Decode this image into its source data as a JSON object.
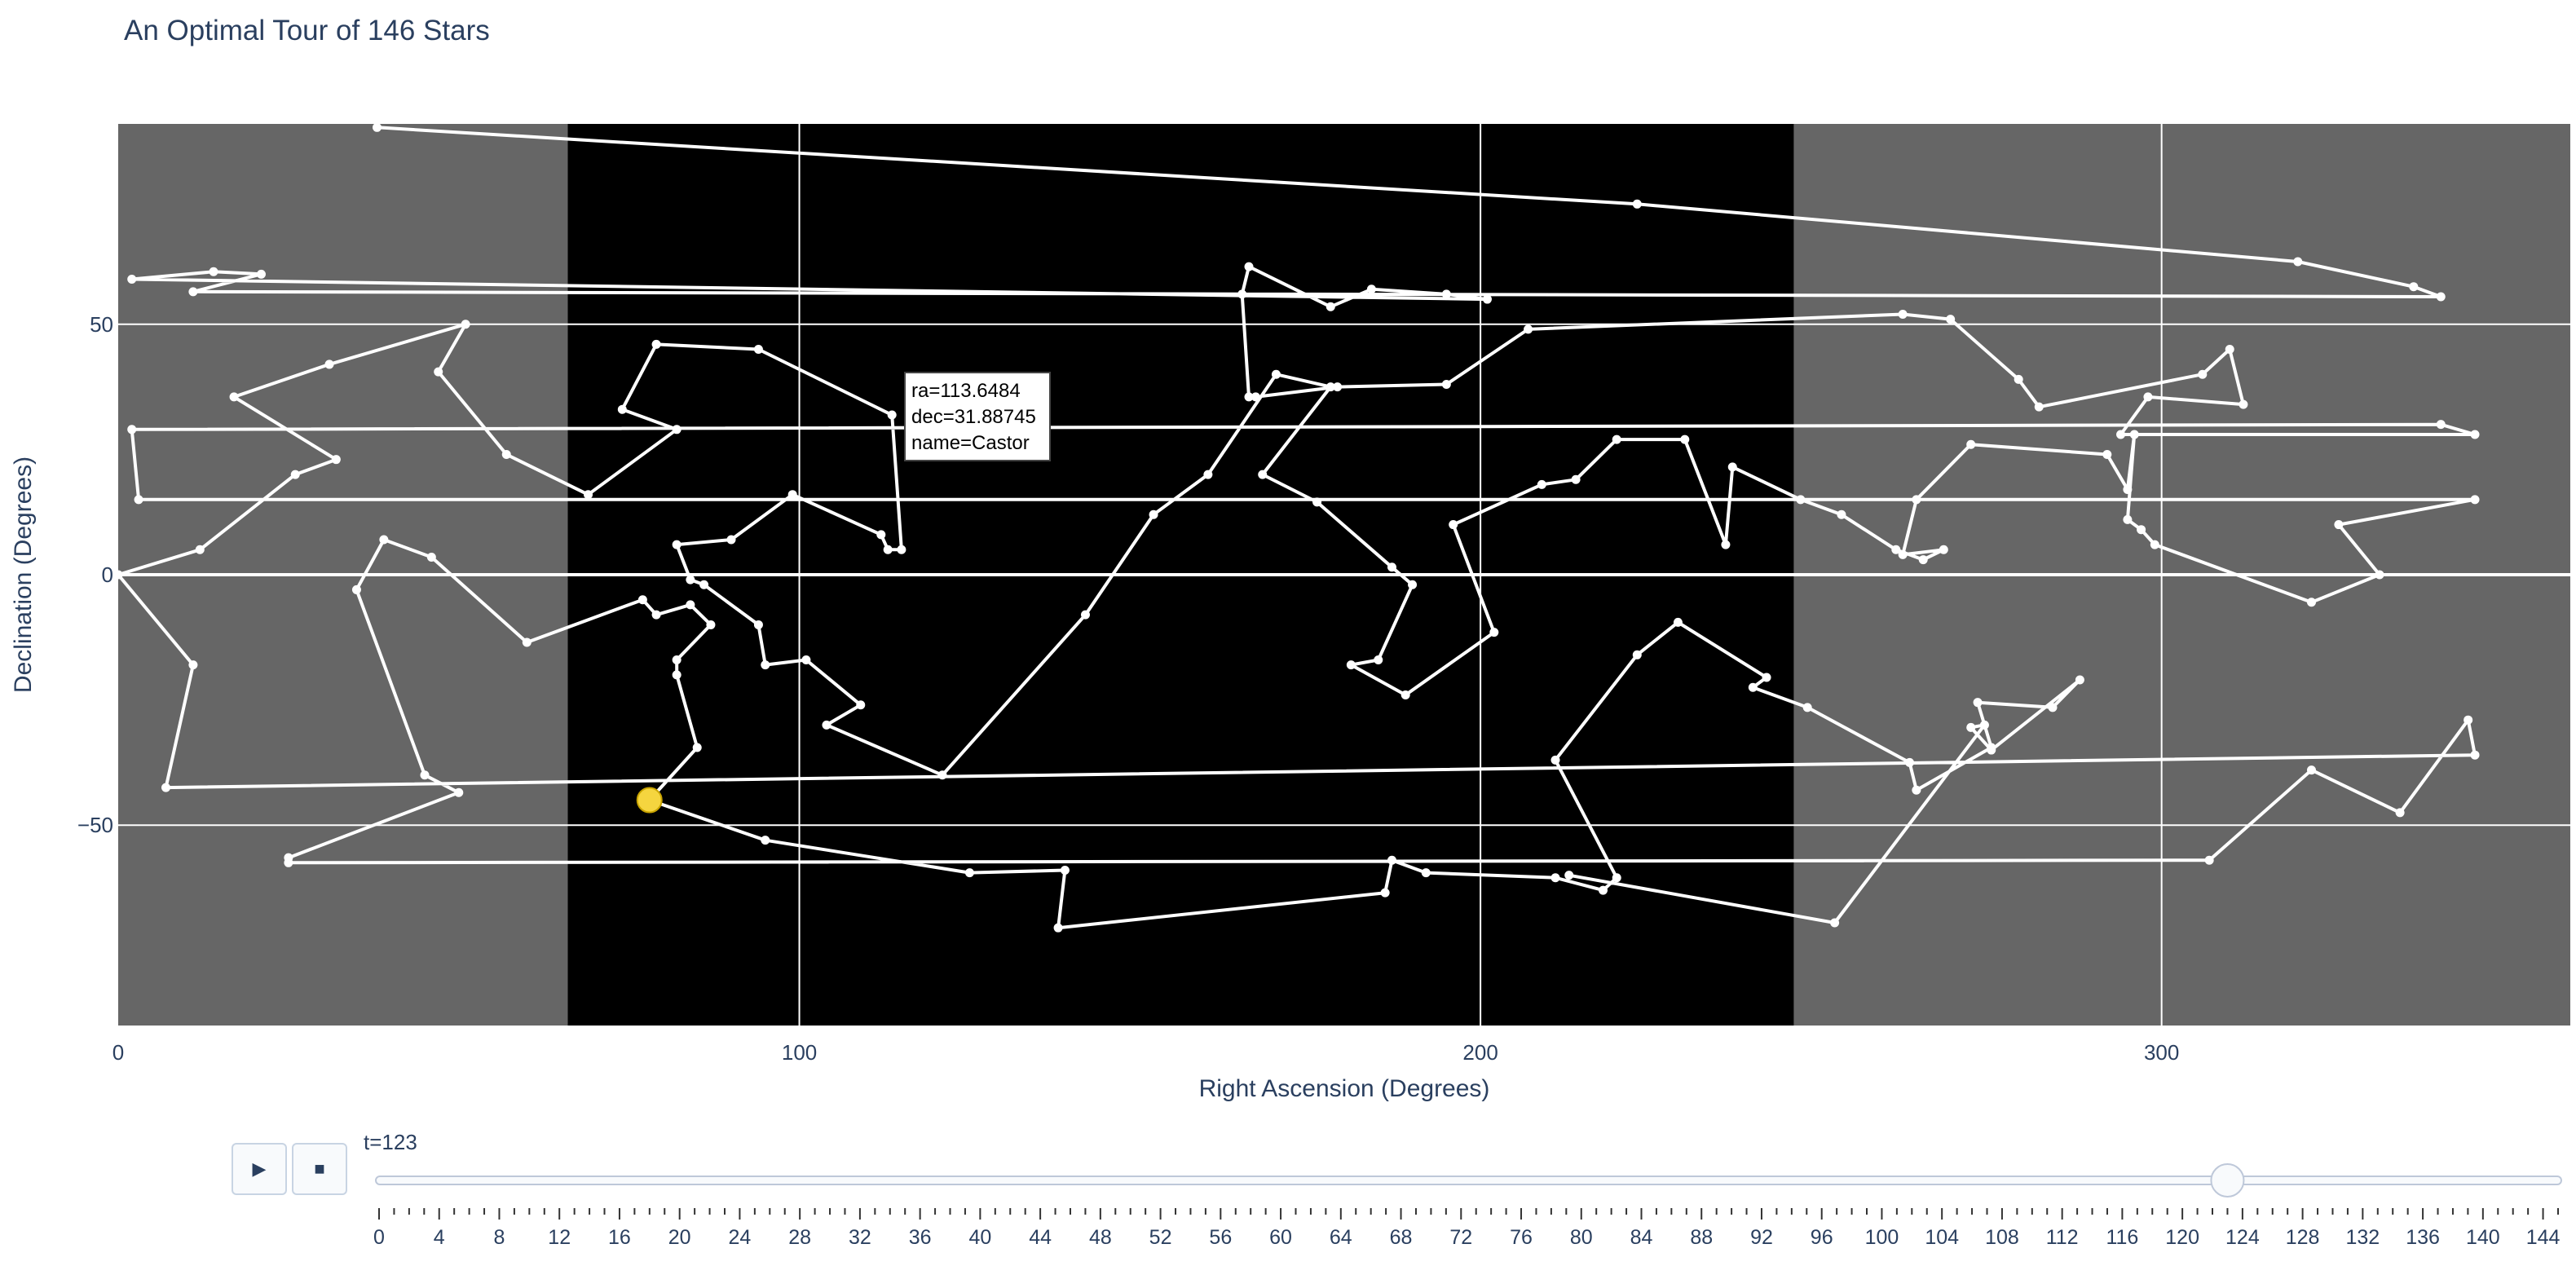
{
  "title": "An Optimal Tour of 146 Stars",
  "chart_data": {
    "type": "scatter",
    "mode": "lines+markers",
    "title": "An Optimal Tour of 146 Stars",
    "xlabel": "Right Ascension (Degrees)",
    "ylabel": "Declination (Degrees)",
    "xlim": [
      0,
      360
    ],
    "ylim": [
      -90,
      90
    ],
    "xticks": [
      0,
      100,
      200,
      300
    ],
    "yticks": [
      -50,
      0,
      50
    ],
    "grid": true,
    "background_bands": [
      {
        "x0": 0,
        "x1": 66,
        "color": "#666666"
      },
      {
        "x0": 66,
        "x1": 246,
        "color": "#000000"
      },
      {
        "x0": 246,
        "x1": 360,
        "color": "#666666"
      }
    ],
    "line_color": "#ffffff",
    "highlight_color": "#f5d53f",
    "tour": [
      [
        38,
        89.3
      ],
      [
        223,
        74
      ],
      [
        320,
        62.5
      ],
      [
        337,
        57.5
      ],
      [
        341,
        55.5
      ],
      [
        11,
        56.5
      ],
      [
        21,
        60
      ],
      [
        14,
        60.5
      ],
      [
        2,
        59
      ],
      [
        201,
        55
      ],
      [
        195,
        56
      ],
      [
        184,
        57
      ],
      [
        178,
        53.5
      ],
      [
        166,
        61.5
      ],
      [
        165,
        56
      ],
      [
        166,
        35.5
      ],
      [
        167,
        35.5
      ],
      [
        179,
        37.5
      ],
      [
        195,
        38
      ],
      [
        207,
        49
      ],
      [
        262,
        52
      ],
      [
        269,
        51
      ],
      [
        279,
        39
      ],
      [
        282,
        33.5
      ],
      [
        306,
        40
      ],
      [
        310,
        45
      ],
      [
        312,
        34
      ],
      [
        298,
        35.5
      ],
      [
        294,
        28
      ],
      [
        346,
        28
      ],
      [
        341,
        30
      ],
      [
        2,
        29
      ],
      [
        3,
        15
      ],
      [
        346,
        15
      ],
      [
        326,
        10
      ],
      [
        332,
        0
      ],
      [
        322,
        -5.5
      ],
      [
        299,
        6
      ],
      [
        297,
        9
      ],
      [
        295,
        11
      ],
      [
        296,
        28
      ],
      [
        295,
        17
      ],
      [
        292,
        24
      ],
      [
        272,
        26
      ],
      [
        264,
        15
      ],
      [
        262,
        4
      ],
      [
        268,
        5
      ],
      [
        265,
        3
      ],
      [
        261,
        5
      ],
      [
        253,
        12
      ],
      [
        247,
        15
      ],
      [
        237,
        21.5
      ],
      [
        236,
        6
      ],
      [
        230,
        27
      ],
      [
        220,
        27
      ],
      [
        214,
        19
      ],
      [
        209,
        18
      ],
      [
        196,
        10
      ],
      [
        202,
        -11.5
      ],
      [
        189,
        -24
      ],
      [
        181,
        -18
      ],
      [
        185,
        -17
      ],
      [
        190,
        -2
      ],
      [
        187,
        1.5
      ],
      [
        176,
        14.5
      ],
      [
        168,
        20
      ],
      [
        178,
        37.5
      ],
      [
        170,
        40
      ],
      [
        160,
        20
      ],
      [
        152,
        12
      ],
      [
        142,
        -8
      ],
      [
        121,
        -40
      ],
      [
        104,
        -30
      ],
      [
        109,
        -26
      ],
      [
        101,
        -17
      ],
      [
        95,
        -18
      ],
      [
        94,
        -10
      ],
      [
        86,
        -2
      ],
      [
        84,
        -1
      ],
      [
        82,
        6
      ],
      [
        90,
        7
      ],
      [
        99,
        16
      ],
      [
        112,
        8
      ],
      [
        113,
        5
      ],
      [
        115,
        5
      ],
      [
        113.6,
        31.9
      ],
      [
        94,
        45
      ],
      [
        79,
        46
      ],
      [
        74,
        33
      ],
      [
        82,
        29
      ],
      [
        69,
        16
      ],
      [
        57,
        24
      ],
      [
        47,
        40.5
      ],
      [
        51,
        50
      ],
      [
        31,
        42
      ],
      [
        17,
        35.5
      ],
      [
        32,
        23
      ],
      [
        26,
        20
      ],
      [
        12,
        5
      ],
      [
        0,
        0
      ],
      [
        11,
        -18
      ],
      [
        7,
        -42.5
      ],
      [
        346,
        -36
      ],
      [
        345,
        -29
      ],
      [
        335,
        -47.5
      ],
      [
        322,
        -39
      ],
      [
        307,
        -57
      ],
      [
        25,
        -57.5
      ],
      [
        25,
        -56.5
      ],
      [
        50,
        -43.5
      ],
      [
        45,
        -40
      ],
      [
        35,
        -3
      ],
      [
        39,
        7
      ],
      [
        46,
        3.5
      ],
      [
        60,
        -13.5
      ],
      [
        77,
        -5
      ],
      [
        79,
        -8
      ],
      [
        84,
        -6
      ],
      [
        87,
        -10
      ],
      [
        82,
        -17
      ],
      [
        82,
        -20
      ],
      [
        85,
        -34.5
      ],
      [
        78,
        -45
      ]
    ],
    "tour_after_highlight": [
      [
        78,
        -45
      ],
      [
        95,
        -53
      ],
      [
        125,
        -59.5
      ],
      [
        139,
        -59
      ],
      [
        138,
        -70.5
      ],
      [
        186,
        -63.5
      ],
      [
        187,
        -57
      ],
      [
        192,
        -59.5
      ],
      [
        211,
        -60.5
      ],
      [
        218,
        -63
      ],
      [
        220,
        -60.5
      ],
      [
        211,
        -37
      ],
      [
        223,
        -16
      ],
      [
        229,
        -9.5
      ],
      [
        242,
        -20.5
      ],
      [
        240,
        -22.5
      ],
      [
        248,
        -26.5
      ],
      [
        263,
        -37.5
      ],
      [
        264,
        -43
      ],
      [
        275,
        -34.5
      ],
      [
        273,
        -25.5
      ],
      [
        284,
        -26.5
      ],
      [
        288,
        -21
      ],
      [
        275,
        -35
      ],
      [
        272,
        -30.5
      ],
      [
        274,
        -30
      ],
      [
        252,
        -69.5
      ],
      [
        213,
        -60
      ]
    ],
    "highlighted_point": {
      "ra": 78,
      "dec": -45
    },
    "tooltip": {
      "ra": "ra=113.6484",
      "dec": "dec=31.88745",
      "name": "name=Castor"
    }
  },
  "animation": {
    "play_label": "▶",
    "stop_label": "■",
    "current_label": "t=123",
    "current_value": 123,
    "min": 0,
    "max": 145,
    "tick_labels": [
      "0",
      "4",
      "8",
      "12",
      "16",
      "20",
      "24",
      "28",
      "32",
      "36",
      "40",
      "44",
      "48",
      "52",
      "56",
      "60",
      "64",
      "68",
      "72",
      "76",
      "80",
      "84",
      "88",
      "92",
      "96",
      "100",
      "104",
      "108",
      "112",
      "116",
      "120",
      "124",
      "128",
      "132",
      "136",
      "140",
      "144"
    ]
  }
}
